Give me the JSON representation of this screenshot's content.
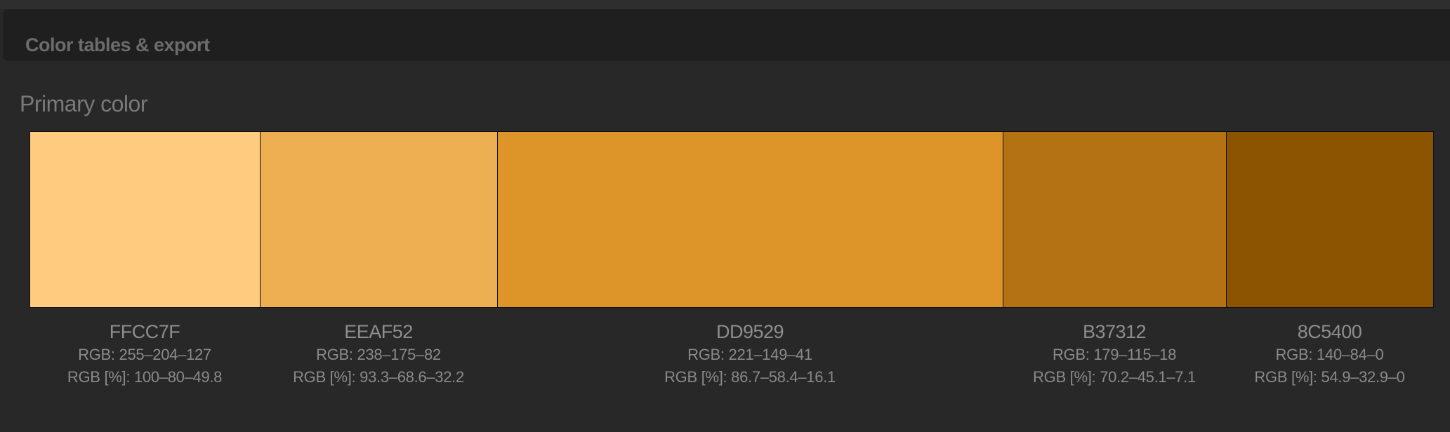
{
  "header": {
    "title": "Color tables & export"
  },
  "section": {
    "title": "Primary color"
  },
  "swatches": [
    {
      "hex": "FFCC7F",
      "color": "#FFCC7F",
      "rgb": "RGB: 255–204–127",
      "rgb_pct": "RGB [%]: 100–80–49.8"
    },
    {
      "hex": "EEAF52",
      "color": "#EEAF52",
      "rgb": "RGB: 238–175–82",
      "rgb_pct": "RGB [%]: 93.3–68.6–32.2"
    },
    {
      "hex": "DD9529",
      "color": "#DD9529",
      "rgb": "RGB: 221–149–41",
      "rgb_pct": "RGB [%]: 86.7–58.4–16.1"
    },
    {
      "hex": "B37312",
      "color": "#B37312",
      "rgb": "RGB: 179–115–18",
      "rgb_pct": "RGB [%]: 70.2–45.1–7.1"
    },
    {
      "hex": "8C5400",
      "color": "#8C5400",
      "rgb": "RGB: 140–84–0",
      "rgb_pct": "RGB [%]: 54.9–32.9–0"
    }
  ]
}
